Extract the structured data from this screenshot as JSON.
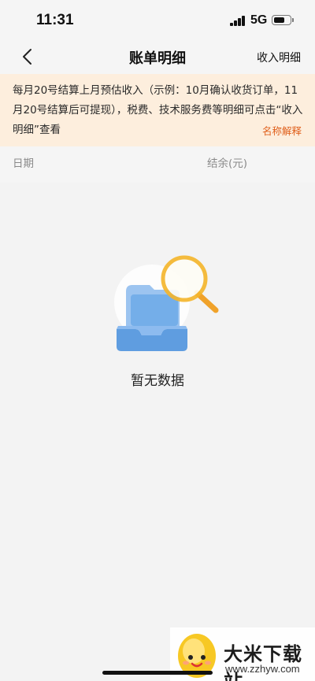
{
  "status_bar": {
    "time": "11:31",
    "network": "5G",
    "icons": [
      "signal-icon",
      "battery-icon"
    ]
  },
  "nav": {
    "title": "账单明细",
    "back_icon": "chevron-left-icon",
    "right_link": "收入明细"
  },
  "notice": {
    "text": "每月20号结算上月预估收入（示例：10月确认收货订单，11月20号结算后可提现），税费、技术服务费等明细可点击“收入明细”查看",
    "link": "名称解释"
  },
  "table": {
    "columns": [
      "日期",
      "结余(元)"
    ]
  },
  "empty_state": {
    "icon": "empty-tray-magnifier-icon",
    "text": "暂无数据"
  },
  "watermark": {
    "title": "大米下载站",
    "url": "www.zzhyw.com"
  },
  "colors": {
    "notice_bg": "#fdeedd",
    "accent": "#e0601c",
    "page_bg": "#f3f3f3",
    "tray_blue": "#6aa6e8",
    "magnifier_gold": "#f5b52a"
  }
}
